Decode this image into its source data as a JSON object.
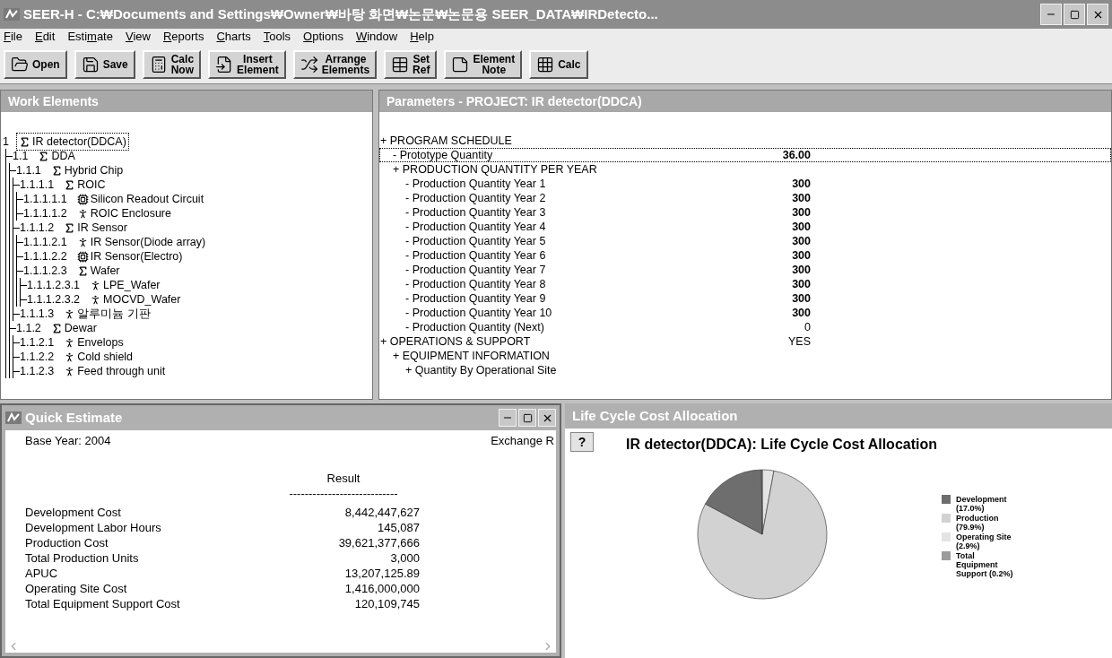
{
  "window": {
    "title": "SEER-H - C:₩Documents and Settings₩Owner₩바탕 화면₩논문₩논문용 SEER_DATA₩IRDetecto..."
  },
  "menu": [
    {
      "key": "F",
      "rest": "ile"
    },
    {
      "key": "E",
      "rest": "dit"
    },
    {
      "lead": "Esti",
      "key": "m",
      "rest": "ate"
    },
    {
      "key": "V",
      "rest": "iew"
    },
    {
      "key": "R",
      "rest": "eports"
    },
    {
      "key": "C",
      "rest": "harts"
    },
    {
      "key": "T",
      "rest": "ools"
    },
    {
      "key": "O",
      "rest": "ptions"
    },
    {
      "key": "W",
      "rest": "indow"
    },
    {
      "key": "H",
      "rest": "elp"
    }
  ],
  "toolbar": [
    {
      "kind": "open",
      "lines": [
        "Open"
      ]
    },
    {
      "kind": "save",
      "lines": [
        "Save"
      ]
    },
    {
      "kind": "calc-now",
      "lines": [
        "Calc",
        "Now"
      ]
    },
    {
      "kind": "insert",
      "lines": [
        "Insert",
        "Element"
      ]
    },
    {
      "kind": "arrange",
      "lines": [
        "Arrange",
        "Elements"
      ]
    },
    {
      "kind": "setref",
      "lines": [
        "Set",
        "Ref"
      ]
    },
    {
      "kind": "note",
      "lines": [
        "Element",
        "Note"
      ]
    },
    {
      "kind": "calc",
      "lines": [
        "Calc"
      ]
    }
  ],
  "work_elements": {
    "title": "Work Elements",
    "tree": [
      {
        "number": "1",
        "label": "IR detector(DDCA)",
        "kind": "sum",
        "selected": true,
        "children": [
          {
            "number": "1.1",
            "label": "DDA",
            "kind": "sum",
            "selected": false,
            "children": [
              {
                "number": "1.1.1",
                "label": "Hybrid Chip",
                "kind": "sum",
                "selected": false,
                "children": [
                  {
                    "number": "1.1.1.1",
                    "label": "ROIC",
                    "kind": "sum",
                    "selected": false,
                    "children": [
                      {
                        "number": "1.1.1.1.1",
                        "label": "Silicon Readout Circuit",
                        "kind": "chip",
                        "selected": false
                      },
                      {
                        "number": "1.1.1.1.2",
                        "label": "ROIC Enclosure",
                        "kind": "figure",
                        "selected": false
                      }
                    ]
                  },
                  {
                    "number": "1.1.1.2",
                    "label": "IR Sensor",
                    "kind": "sum",
                    "selected": false,
                    "children": [
                      {
                        "number": "1.1.1.2.1",
                        "label": "IR Sensor(Diode array)",
                        "kind": "figure",
                        "selected": false
                      },
                      {
                        "number": "1.1.1.2.2",
                        "label": "IR Sensor(Electro)",
                        "kind": "chip",
                        "selected": false
                      },
                      {
                        "number": "1.1.1.2.3",
                        "label": "Wafer",
                        "kind": "sum",
                        "selected": false,
                        "children": [
                          {
                            "number": "1.1.1.2.3.1",
                            "label": "LPE_Wafer",
                            "kind": "figure",
                            "selected": false
                          },
                          {
                            "number": "1.1.1.2.3.2",
                            "label": "MOCVD_Wafer",
                            "kind": "figure",
                            "selected": false
                          }
                        ]
                      }
                    ]
                  },
                  {
                    "number": "1.1.1.3",
                    "label": "알루미늄 기판",
                    "kind": "figure",
                    "selected": false
                  }
                ]
              },
              {
                "number": "1.1.2",
                "label": "Dewar",
                "kind": "sum",
                "selected": false,
                "children": [
                  {
                    "number": "1.1.2.1",
                    "label": "Envelops",
                    "kind": "figure",
                    "selected": false
                  },
                  {
                    "number": "1.1.2.2",
                    "label": "Cold shield",
                    "kind": "figure",
                    "selected": false
                  },
                  {
                    "number": "1.1.2.3",
                    "label": "Feed through unit",
                    "kind": "figure",
                    "selected": false
                  }
                ]
              }
            ]
          }
        ]
      }
    ]
  },
  "parameters": {
    "title": "Parameters - PROJECT: IR detector(DDCA)",
    "rows": [
      {
        "label": "+ PROGRAM SCHEDULE",
        "selected": false,
        "children": [
          {
            "label": "- Prototype Quantity",
            "value": "36.00",
            "user_set": true,
            "selected": true
          },
          {
            "label": "+ PRODUCTION QUANTITY PER YEAR",
            "selected": false,
            "children": [
              {
                "label": "- Production Quantity Year 1",
                "value": "300",
                "user_set": true,
                "selected": false
              },
              {
                "label": "- Production Quantity Year 2",
                "value": "300",
                "user_set": true,
                "selected": false
              },
              {
                "label": "- Production Quantity Year 3",
                "value": "300",
                "user_set": true,
                "selected": false
              },
              {
                "label": "- Production Quantity Year 4",
                "value": "300",
                "user_set": true,
                "selected": false
              },
              {
                "label": "- Production Quantity Year 5",
                "value": "300",
                "user_set": true,
                "selected": false
              },
              {
                "label": "- Production Quantity Year 6",
                "value": "300",
                "user_set": true,
                "selected": false
              },
              {
                "label": "- Production Quantity Year 7",
                "value": "300",
                "user_set": true,
                "selected": false
              },
              {
                "label": "- Production Quantity Year 8",
                "value": "300",
                "user_set": true,
                "selected": false
              },
              {
                "label": "- Production Quantity Year 9",
                "value": "300",
                "user_set": true,
                "selected": false
              },
              {
                "label": "- Production Quantity Year 10",
                "value": "300",
                "user_set": true,
                "selected": false
              },
              {
                "label": "- Production Quantity (Next)",
                "value": "0",
                "user_set": false,
                "selected": false
              }
            ]
          }
        ]
      },
      {
        "label": "+ OPERATIONS & SUPPORT",
        "value": "YES",
        "user_set": false,
        "selected": false,
        "children": [
          {
            "label": "+ EQUIPMENT INFORMATION",
            "selected": false,
            "children": [
              {
                "label": "+ Quantity By Operational Site",
                "selected": false
              }
            ]
          }
        ]
      }
    ]
  },
  "quick_estimate": {
    "title": "Quick Estimate",
    "base_year": "Base Year: 2004",
    "exchange": "Exchange R",
    "result_heading": "Result",
    "separator": "----------------------------",
    "rows": [
      {
        "label": "Development Cost",
        "value": "8,442,447,627"
      },
      {
        "label": "Development Labor Hours",
        "value": "145,087"
      },
      {
        "label": "Production Cost",
        "value": "39,621,377,666"
      },
      {
        "label": "Total Production Units",
        "value": "3,000"
      },
      {
        "label": "APUC",
        "value": "13,207,125.89"
      },
      {
        "label": "Operating Site Cost",
        "value": "1,416,000,000"
      },
      {
        "label": "Total Equipment Support Cost",
        "value": "120,109,745"
      }
    ]
  },
  "lcc_window": {
    "title": "Life Cycle Cost Allocation",
    "help_button": "?",
    "chart_data": {
      "type": "pie",
      "title": "IR detector(DDCA): Life Cycle Cost Allocation",
      "categories": [
        "Development",
        "Production",
        "Operating Site",
        "Total Equipment Support"
      ],
      "values": [
        17.0,
        79.9,
        2.9,
        0.2
      ],
      "value_labels": [
        "(17.0%)",
        "(79.9%)",
        "(2.9%)",
        "(0.2%)"
      ],
      "colors": [
        "#6e6e6e",
        "#d2d2d2",
        "#e4e4e4",
        "#9c9c9c"
      ],
      "legend": "right"
    }
  }
}
